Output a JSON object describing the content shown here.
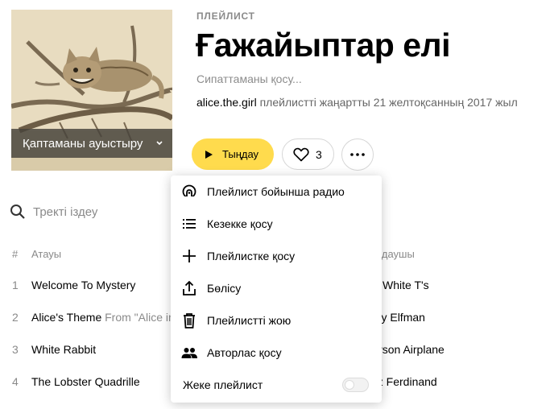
{
  "playlist": {
    "type_label": "ПЛЕЙЛИСТ",
    "title": "Ғажайыптар елі",
    "description_placeholder": "Сипаттаманы қосу...",
    "owner": "alice.the.girl",
    "updated_text": "плейлистті жаңартты 21 желтоқсанның 2017 жыл",
    "cover_change_label": "Қаптаманы ауыстыру"
  },
  "actions": {
    "play_label": "Тыңдау",
    "like_count": "3"
  },
  "search": {
    "placeholder": "Тректі іздеу"
  },
  "table": {
    "col_num": "#",
    "col_title": "Атауы",
    "col_artist": "Орындаушы",
    "rows": [
      {
        "num": "1",
        "title": "Welcome To Mystery",
        "version": "",
        "artist": "Plain White T's"
      },
      {
        "num": "2",
        "title": "Alice's Theme",
        "version": "From \"Alice in Wonderland\"",
        "artist": "Danny Elfman"
      },
      {
        "num": "3",
        "title": "White Rabbit",
        "version": "",
        "artist": "Jefferson Airplane"
      },
      {
        "num": "4",
        "title": "The Lobster Quadrille",
        "version": "",
        "artist": "Franz Ferdinand"
      }
    ]
  },
  "menu": {
    "items": [
      {
        "label": "Плейлист бойынша радио",
        "icon": "radio-icon"
      },
      {
        "label": "Кезекке қосу",
        "icon": "queue-icon"
      },
      {
        "label": "Плейлистке қосу",
        "icon": "plus-icon"
      },
      {
        "label": "Бөлісу",
        "icon": "share-icon"
      },
      {
        "label": "Плейлистті жою",
        "icon": "trash-icon"
      },
      {
        "label": "Авторлас қосу",
        "icon": "coauthors-icon"
      }
    ],
    "private_label": "Жеке плейлист",
    "private_enabled": false
  },
  "colors": {
    "accent": "#ffdb4d",
    "muted": "#8a8a8a"
  }
}
